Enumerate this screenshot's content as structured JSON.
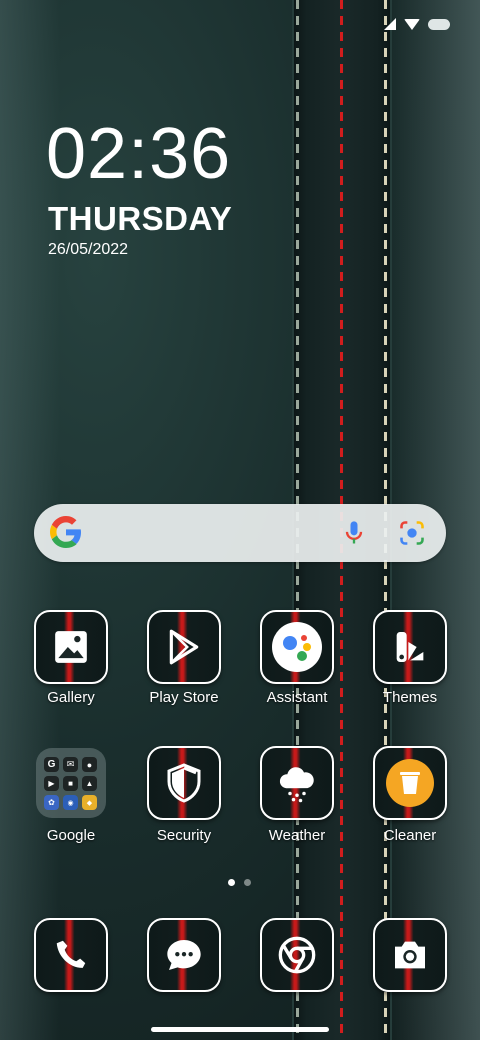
{
  "clock": {
    "time": "02:36",
    "day": "THURSDAY",
    "date": "26/05/2022"
  },
  "status_bar": {
    "icons": [
      "signal-icon",
      "wifi-icon",
      "battery-icon"
    ]
  },
  "search": {
    "icons": [
      "google-logo",
      "mic-icon",
      "lens-icon"
    ]
  },
  "apps_row1": [
    {
      "label": "Gallery",
      "icon": "gallery-icon"
    },
    {
      "label": "Play Store",
      "icon": "play-store-icon"
    },
    {
      "label": "Assistant",
      "icon": "assistant-icon"
    },
    {
      "label": "Themes",
      "icon": "themes-icon"
    }
  ],
  "apps_row2": [
    {
      "label": "Google",
      "icon": "google-folder"
    },
    {
      "label": "Security",
      "icon": "shield-icon"
    },
    {
      "label": "Weather",
      "icon": "cloud-icon"
    },
    {
      "label": "Cleaner",
      "icon": "trash-icon"
    }
  ],
  "dock": [
    {
      "icon": "phone-icon"
    },
    {
      "icon": "messages-icon"
    },
    {
      "icon": "chrome-icon"
    },
    {
      "icon": "camera-icon"
    }
  ],
  "pages": {
    "count": 2,
    "active": 1
  },
  "colors": {
    "stitch_red": "#d21d1d",
    "stitch_cream": "#d8d3b8",
    "tile_border": "#ffffff"
  }
}
